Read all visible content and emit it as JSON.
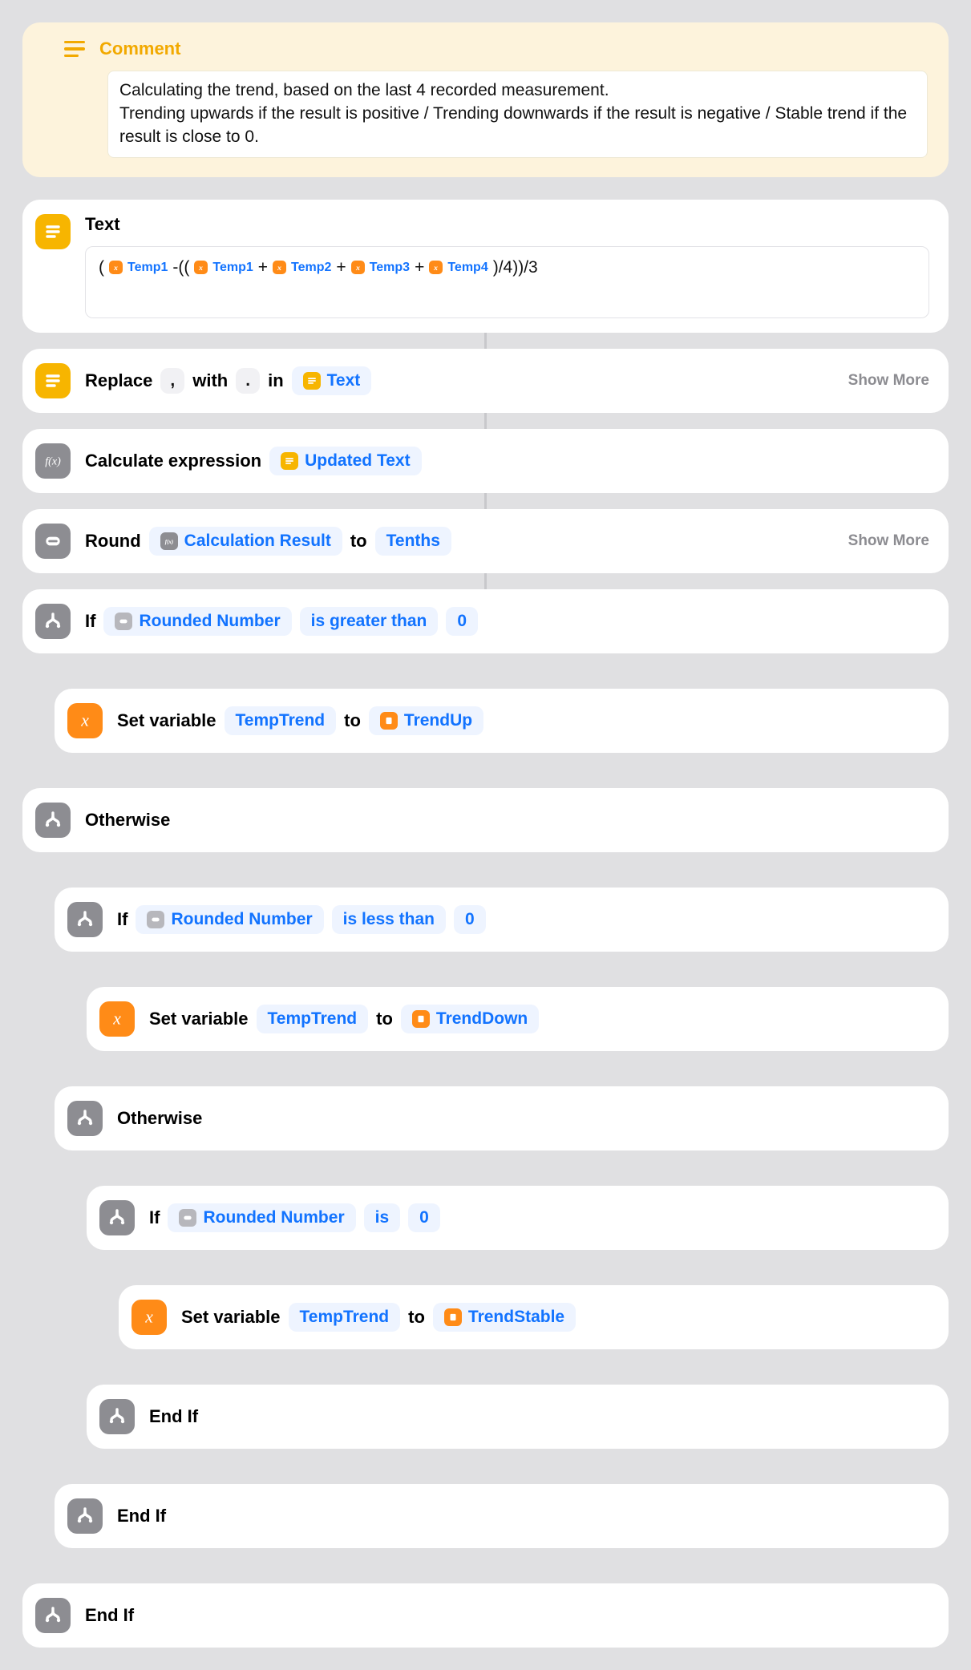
{
  "comment": {
    "label": "Comment",
    "body": "Calculating the trend, based on the last 4 recorded measurement.\nTrending upwards if the result is positive / Trending downwards if the result is negative / Stable trend if the result is close to 0."
  },
  "text_action": {
    "title": "Text",
    "expr_open": "(",
    "temp1": "Temp1",
    "dash": " -((",
    "plus": " + ",
    "temp2": "Temp2",
    "temp3": "Temp3",
    "temp4": "Temp4",
    "expr_close": " )/4))/3"
  },
  "replace": {
    "verb": "Replace",
    "find": ",",
    "with_label": "with",
    "replace": ".",
    "in_label": "in",
    "target": "Text",
    "show_more": "Show More"
  },
  "calc": {
    "verb": "Calculate expression",
    "target": "Updated Text"
  },
  "round": {
    "verb": "Round",
    "input": "Calculation Result",
    "to": "to",
    "precision": "Tenths",
    "show_more": "Show More"
  },
  "if1": {
    "if": "If",
    "var": "Rounded Number",
    "cond": "is greater than",
    "val": "0"
  },
  "set1": {
    "verb": "Set variable",
    "var": "TempTrend",
    "to": "to",
    "val": "TrendUp"
  },
  "otherwise": "Otherwise",
  "if2": {
    "if": "If",
    "var": "Rounded Number",
    "cond": "is less than",
    "val": "0"
  },
  "set2": {
    "verb": "Set variable",
    "var": "TempTrend",
    "to": "to",
    "val": "TrendDown"
  },
  "if3": {
    "if": "If",
    "var": "Rounded Number",
    "cond": "is",
    "val": "0"
  },
  "set3": {
    "verb": "Set variable",
    "var": "TempTrend",
    "to": "to",
    "val": "TrendStable"
  },
  "endif": "End If"
}
